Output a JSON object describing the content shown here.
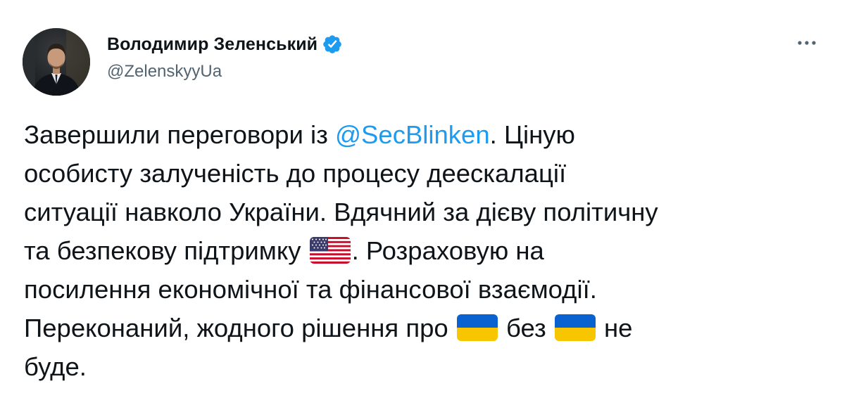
{
  "author": {
    "display_name": "Володимир Зеленський",
    "handle": "@ZelenskyyUa",
    "verified": true,
    "avatar": "profile-photo"
  },
  "actions": {
    "more_icon": "more-horizontal-icon"
  },
  "tweet": {
    "lines": [
      [
        "Завершили переговори із ",
        "@SecBlinken",
        ". Ціную"
      ],
      [
        "особисту залученість до процесу деескалації"
      ],
      [
        "ситуації навколо України. Вдячний за дієву політичну"
      ],
      [
        "та безпекову підтримку ",
        ". Розраховую на"
      ],
      [
        "посилення економічної та фінансової взаємодії."
      ],
      [
        "Переконаний, жодного рішення про ",
        " без ",
        " не"
      ],
      [
        "буде."
      ]
    ],
    "emoji": {
      "us_flag": "flag-us-icon",
      "ua_flag": "flag-ua-icon"
    }
  },
  "colors": {
    "text": "#0f1419",
    "secondary": "#536471",
    "link": "#1d9bf0",
    "verified": "#1d9bf0"
  }
}
